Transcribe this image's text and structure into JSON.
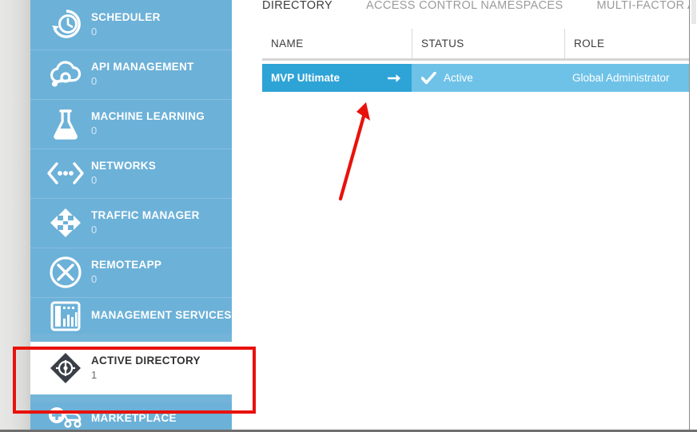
{
  "sidebar": {
    "items": [
      {
        "label": "SCHEDULER",
        "count": "0",
        "icon": "scheduler-clock-icon",
        "active": false
      },
      {
        "label": "API MANAGEMENT",
        "count": "0",
        "icon": "api-management-cloud-icon",
        "active": false
      },
      {
        "label": "MACHINE LEARNING",
        "count": "0",
        "icon": "machine-learning-flask-icon",
        "active": false
      },
      {
        "label": "NETWORKS",
        "count": "0",
        "icon": "networks-icon",
        "active": false
      },
      {
        "label": "TRAFFIC MANAGER",
        "count": "0",
        "icon": "traffic-manager-icon",
        "active": false
      },
      {
        "label": "REMOTEAPP",
        "count": "0",
        "icon": "remoteapp-icon",
        "active": false
      },
      {
        "label": "MANAGEMENT SERVICES",
        "count": "",
        "icon": "management-services-icon",
        "active": false
      },
      {
        "label": "ACTIVE DIRECTORY",
        "count": "1",
        "icon": "active-directory-diamond-icon",
        "active": true
      },
      {
        "label": "MARKETPLACE",
        "count": "",
        "icon": "marketplace-cart-icon",
        "active": false
      }
    ]
  },
  "main": {
    "tabs": [
      {
        "label": "DIRECTORY",
        "selected": true
      },
      {
        "label": "ACCESS CONTROL NAMESPACES",
        "selected": false
      },
      {
        "label": "MULTI-FACTOR AUTH PROV",
        "selected": false
      }
    ],
    "table": {
      "columns": [
        "NAME",
        "STATUS",
        "ROLE"
      ],
      "rows": [
        {
          "name": "MVP Ultimate",
          "status": "Active",
          "role": "Global Administrator",
          "arrow": "→",
          "status_icon": "checkmark-icon"
        }
      ]
    }
  },
  "annotations": {
    "highlight_rect_color": "#e8120c",
    "arrow_color": "#e8120c"
  },
  "colors": {
    "sidebar_blue": "#6cb1d8",
    "row_light_blue": "#6ec2e8",
    "row_name_blue": "#2ea3d6",
    "accent_red": "#e8120c"
  }
}
